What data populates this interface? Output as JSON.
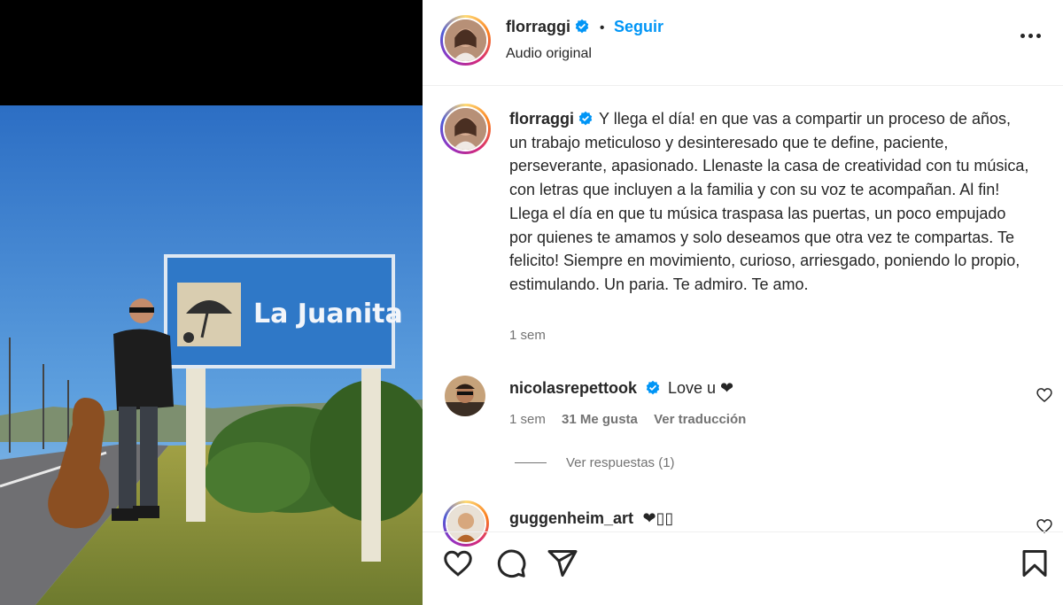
{
  "post": {
    "username": "florraggi",
    "follow_label": "Seguir",
    "separator": "•",
    "subtitle": "Audio original",
    "caption": "Y llega el día! en que vas a compartir un proceso de años, un trabajo meticuloso y desinteresado que te define, paciente, perseverante, apasionado. Llenaste la casa de creatividad con tu música, con letras que incluyen a la familia y con su voz te acompañan. Al fin! Llega el día en que tu música traspasa las puertas, un poco empujado por quienes te amamos y solo deseamos que otra vez te compartas. Te felicito! Siempre en movimiento, curioso, arriesgado, poniendo lo propio, estimulando. Un paria. Te admiro. Te amo.",
    "time": "1 sem"
  },
  "photo": {
    "sign_text": "La Juanita"
  },
  "comments": [
    {
      "username": "nicolasrepettook",
      "text": "Love u ❤",
      "time": "1 sem",
      "likes": "31 Me gusta",
      "translate": "Ver traducción",
      "replies": "Ver respuestas (1)"
    },
    {
      "username": "guggenheim_art",
      "text": "❤▯▯"
    }
  ],
  "colors": {
    "accent": "#0095f6",
    "text": "#262626",
    "muted": "#737373",
    "verified": "#0095f6"
  },
  "icons": {
    "verified": "verified-badge-icon",
    "more": "more-options-icon",
    "like": "heart-icon",
    "comment": "comment-icon",
    "share": "share-icon",
    "save": "bookmark-icon"
  }
}
